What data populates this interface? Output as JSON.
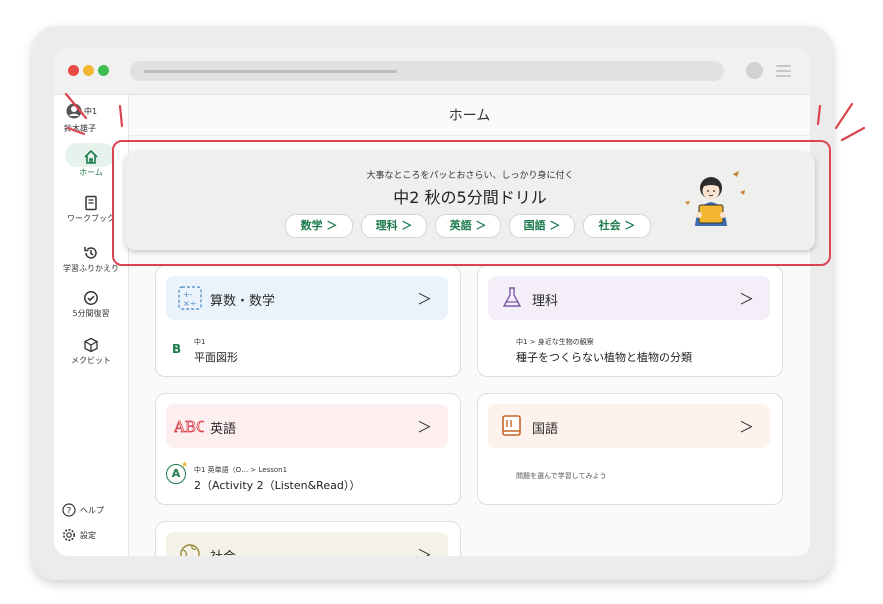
{
  "user": {
    "grade": "中1",
    "name": "鈴木雄子"
  },
  "sidebar": {
    "items": [
      {
        "label": "ホーム"
      },
      {
        "label": "ワークブック"
      },
      {
        "label": "学習ふりかえり"
      },
      {
        "label": "5分間復習"
      },
      {
        "label": "メクビット"
      }
    ],
    "help": "ヘルプ",
    "settings": "設定"
  },
  "header": {
    "title": "ホーム"
  },
  "banner": {
    "subtitle": "大事なところをパッとおさらい、しっかり身に付く",
    "title": "中2 秋の5分間ドリル",
    "buttons": [
      "数学 ＞",
      "理科 ＞",
      "英語 ＞",
      "国語 ＞",
      "社会 ＞"
    ]
  },
  "cards": [
    {
      "subject": "算数・数学",
      "badge": "B",
      "meta": "中1",
      "detail": "平面図形",
      "chevron": "＞"
    },
    {
      "subject": "理科",
      "meta": "中1 > 身近な生物の観察",
      "detail": "種子をつくらない植物と植物の分類",
      "chevron": "＞"
    },
    {
      "subject": "英語",
      "badge": "A",
      "meta": "中1 英単語（O… > Lesson1",
      "detail": "2（Activity 2（Listen&Read））",
      "chevron": "＞"
    },
    {
      "subject": "国語",
      "detail": "問題を選んで学習してみよう",
      "chevron": "＞"
    },
    {
      "subject": "社会",
      "chevron": "＞"
    }
  ],
  "colors": {
    "accent_green": "#1c7a4c",
    "highlight_red": "#d9464e",
    "dot_red": "#e84b45",
    "dot_yellow": "#f2b630",
    "dot_green": "#3dbd4f"
  }
}
